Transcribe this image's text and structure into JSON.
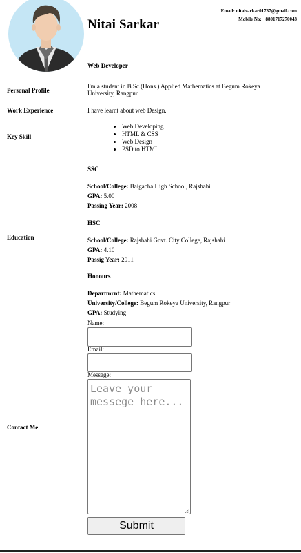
{
  "header": {
    "name": "Nitai Sarkar",
    "email": "Email: nitaisarkar01737@gmail.com",
    "mobile": "Mobile No: +8801717270043",
    "job_title": "Web Developer"
  },
  "sections": {
    "personal_profile": {
      "label": "Personal Profile",
      "text": "I'm a student in B.Sc.(Hons.) Applied Mathematics at Begum Rokeya University, Rangpur."
    },
    "work_experience": {
      "label": "Work Experience",
      "text": "I have learnt about web Design."
    },
    "key_skill": {
      "label": "Key Skill",
      "items": [
        "Web Developing",
        "HTML & CSS",
        "Web Design",
        "PSD to HTML"
      ]
    },
    "education": {
      "label": "Education",
      "ssc": {
        "heading": "SSC",
        "school_label": "School/College:",
        "school": " Baigacha High School, Rajshahi",
        "gpa_label": "GPA:",
        "gpa": " 5.00",
        "year_label": "Passing Year:",
        "year": " 2008"
      },
      "hsc": {
        "heading": "HSC",
        "school_label": "School/College:",
        "school": " Rajshahi Govt. City College, Rajshahi",
        "gpa_label": "GPA:",
        "gpa": " 4.10",
        "year_label": "Passig Year:",
        "year": " 2011"
      },
      "honours": {
        "heading": "Honours",
        "dept_label": "Departmrnt:",
        "dept": " Mathematics",
        "uni_label": "University/College:",
        "uni": " Begum Rokeya University, Rangpur",
        "gpa_label": "GPA:",
        "gpa": " Studying"
      }
    },
    "contact": {
      "label": "Contact Me",
      "name_label": "Name:",
      "email_label": "Email:",
      "message_label": "Message:",
      "message_placeholder": "Leave your messege here...",
      "submit_label": "Submit"
    }
  },
  "colors": {
    "avatar_bg": "#c5e6f5",
    "bottom_rule": "#222222"
  },
  "icons": {
    "avatar": "person-avatar-icon",
    "resize": "resize-grip-icon"
  }
}
